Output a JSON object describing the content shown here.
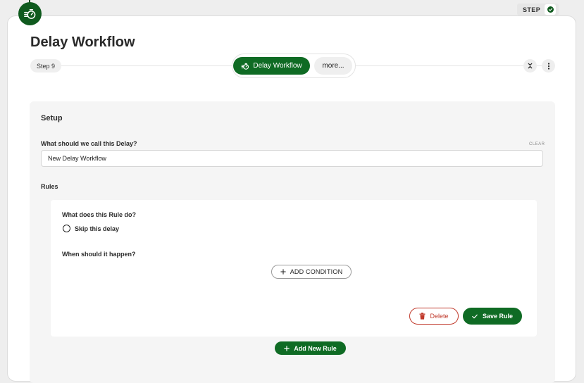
{
  "step_badge": {
    "label": "STEP"
  },
  "header": {
    "title": "Delay Workflow",
    "step_pill": "Step 9",
    "tabs": [
      {
        "label": "Delay Workflow",
        "icon": "timer-icon",
        "active": true
      },
      {
        "label": "more...",
        "active": false
      }
    ]
  },
  "setup": {
    "title": "Setup",
    "name_field": {
      "label": "What should we call this Delay?",
      "clear_label": "CLEAR",
      "value": "New Delay Workflow"
    },
    "rules_label": "Rules",
    "rule": {
      "question1": "What does this Rule do?",
      "option": "Skip this delay",
      "question2": "When should it happen?",
      "add_condition_label": "ADD CONDITION",
      "delete_label": "Delete",
      "save_label": "Save Rule"
    },
    "add_rule_label": "Add New Rule"
  },
  "colors": {
    "primary_green": "#0f6b24",
    "danger_red": "#c0392b"
  }
}
